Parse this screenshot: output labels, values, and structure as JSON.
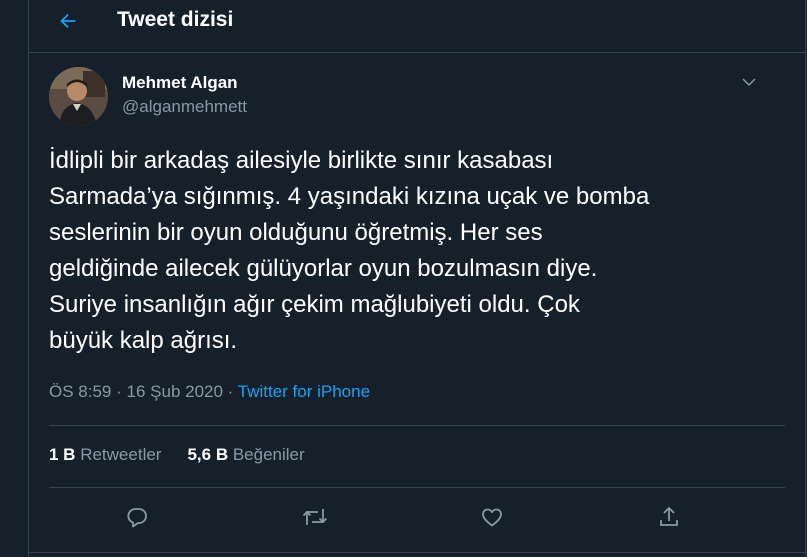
{
  "header": {
    "title": "Tweet dizisi",
    "back_icon": "arrow-left-icon"
  },
  "tweet": {
    "author_name": "Mehmet Algan",
    "author_handle": "@alganmehmett",
    "text": "İdlipli bir arkadaş ailesiyle birlikte sınır kasabası\nSarmada’ya sığınmış. 4 yaşındaki kızına uçak ve bomba\nseslerinin bir oyun olduğunu öğretmiş. Her ses\ngeldiğinde ailecek gülüyorlar oyun bozulmasın diye.\nSuriye insanlığın ağır çekim mağlubiyeti oldu. Çok\nbüyük kalp ağrısı.",
    "time": "ÖS 8:59",
    "separator": "·",
    "date": "16 Şub 2020",
    "source": "Twitter for iPhone"
  },
  "stats": {
    "retweets_count": "1 B",
    "retweets_label": "Retweetler",
    "likes_count": "5,6 B",
    "likes_label": "Beğeniler"
  },
  "actions": [
    "reply-icon",
    "retweet-icon",
    "like-icon",
    "share-icon"
  ],
  "colors": {
    "background": "#15202b",
    "border": "#38444d",
    "secondary_text": "#8899a6",
    "accent": "#1da1f2"
  }
}
